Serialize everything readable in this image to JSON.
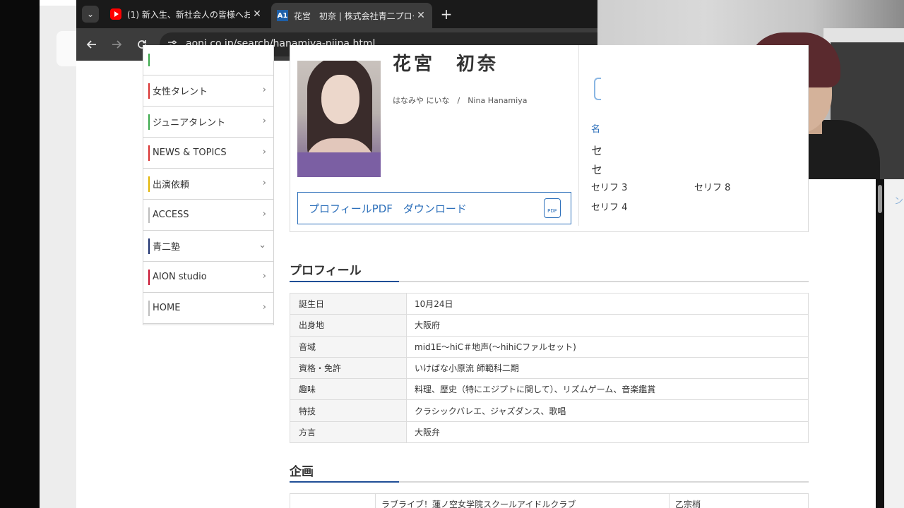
{
  "browser": {
    "tabs": [
      {
        "title": "(1) 新入生、新社会人の皆様へお",
        "favicon": "youtube-icon"
      },
      {
        "title": "花宮　初奈 | 株式会社青二プロダ",
        "favicon": "aoni-icon",
        "favicon_text": "A1"
      }
    ],
    "url": "aoni.co.jp/search/hanamiya-niina.html",
    "close_glyph": "✕",
    "new_tab_glyph": "+",
    "tab_list_glyph": "⌄"
  },
  "sidebar": {
    "items": [
      {
        "label": "女性タレント",
        "accent": "#d9302f",
        "chevron": "›"
      },
      {
        "label": "ジュニアタレント",
        "accent": "#3aa84a",
        "chevron": "›"
      },
      {
        "label": "NEWS & TOPICS",
        "accent": "#d9302f",
        "chevron": "›"
      },
      {
        "label": "出演依頼",
        "accent": "#e2b400",
        "chevron": "›"
      },
      {
        "label": "ACCESS",
        "accent": "#bdbdbd",
        "chevron": "›"
      },
      {
        "label": "青二塾",
        "accent": "#1c2f6e",
        "chevron": "⌄"
      },
      {
        "label": "AION studio",
        "accent": "#c8102e",
        "chevron": "›"
      },
      {
        "label": "HOME",
        "accent": "#bdbdbd",
        "chevron": "›"
      }
    ]
  },
  "talent": {
    "name": "花宮　初奈",
    "reading": "はなみや にいな　/　Nina Hanamiya",
    "pdf_label": "プロフィールPDF　ダウンロード",
    "pdf_icon_text": "PDF"
  },
  "voice_samples": {
    "head": "名",
    "col1": [
      "セ",
      "セ",
      "セリフ 3",
      "セリフ 4"
    ],
    "col2": [
      "セリフ 8"
    ]
  },
  "profile": {
    "heading": "プロフィール",
    "rows": [
      {
        "key": "誕生日",
        "value": "10月24日"
      },
      {
        "key": "出身地",
        "value": "大阪府"
      },
      {
        "key": "音域",
        "value": "mid1E〜hiC＃地声(〜hihiCファルセット)"
      },
      {
        "key": "資格・免許",
        "value": "いけばな小原流 師範科二期"
      },
      {
        "key": "趣味",
        "value": "料理、歴史（特にエジプトに関して）、リズムゲーム、音楽鑑賞"
      },
      {
        "key": "特技",
        "value": "クラシックバレエ、ジャズダンス、歌唱"
      },
      {
        "key": "方言",
        "value": "大阪弁"
      }
    ]
  },
  "kikaku": {
    "heading": "企画",
    "rows": [
      {
        "col1": "",
        "title": "ラブライブ！蓮ノ空女学院スクールアイドルクラブ",
        "role": "乙宗梢"
      }
    ]
  },
  "side_peek": "ンを"
}
